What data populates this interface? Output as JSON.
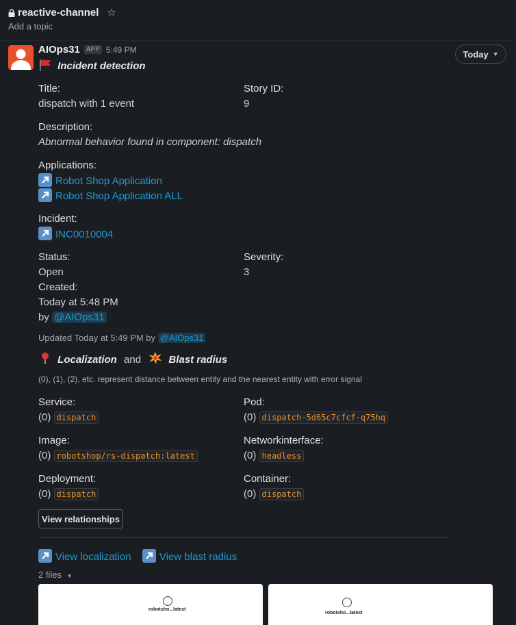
{
  "channel": {
    "name": "reactive-channel",
    "topic": "Add a topic"
  },
  "message": {
    "sender": "AIOps31",
    "badge": "APP",
    "time": "5:49 PM",
    "date_pill": "Today",
    "headline": "Incident detection",
    "headline_icon": "red-flag",
    "title_label": "Title:",
    "title_value": "dispatch with 1 event",
    "story_label": "Story ID:",
    "story_value": "9",
    "description_label": "Description:",
    "description_value": "Abnormal behavior found in component: dispatch",
    "applications_label": "Applications:",
    "applications": [
      "Robot Shop Application",
      "Robot Shop Application ALL"
    ],
    "incident_label": "Incident:",
    "incident_value": "INC0010004",
    "status_label": "Status:",
    "status_value": "Open",
    "severity_label": "Severity:",
    "severity_value": "3",
    "created_label": "Created:",
    "created_value": "Today at 5:48 PM",
    "created_by_prefix": "by",
    "created_by": "@AIOps31",
    "updated_text": "Updated Today at 5:49 PM by",
    "updated_by": "@AIOps31",
    "localization_title": "Localization",
    "and_text": "and",
    "blast_title": "Blast radius",
    "distance_note": "(0), (1), (2), etc. represent distance between entity and the nearest entity with error signal",
    "entities": {
      "service_label": "Service:",
      "service_dist": "(0)",
      "service_value": "dispatch",
      "pod_label": "Pod:",
      "pod_dist": "(0)",
      "pod_value": "dispatch-5d65c7cfcf-q75hq",
      "image_label": "Image:",
      "image_dist": "(0)",
      "image_value": "robotshop/rs-dispatch:latest",
      "netif_label": "Networkinterface:",
      "netif_dist": "(0)",
      "netif_value": "headless",
      "deployment_label": "Deployment:",
      "deployment_dist": "(0)",
      "deployment_value": "dispatch",
      "container_label": "Container:",
      "container_dist": "(0)",
      "container_value": "dispatch"
    },
    "view_relationships": "View relationships",
    "view_localization": "View localization",
    "view_blast": "View blast radius",
    "files_label": "2 files",
    "thumb1_label": "robotsho...latest",
    "thumb2_label": "robotsho...latest"
  },
  "colors": {
    "background": "#1a1d21",
    "link": "#1d9bd1",
    "code": "#e8912d",
    "avatar": "#e8512e"
  }
}
